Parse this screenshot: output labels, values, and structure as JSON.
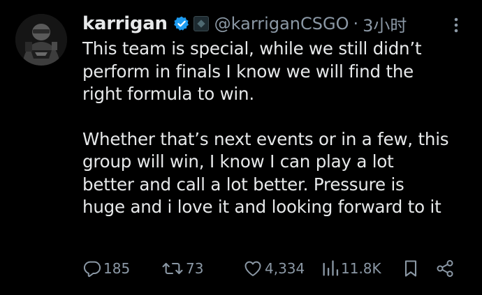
{
  "author": {
    "display_name": "karrigan",
    "handle": "@karriganCSGO",
    "separator": "·",
    "time": "3小时",
    "verified_color": "#1d9bf0",
    "avatar_icon": "avatar-image",
    "more_icon": "more-options-icon"
  },
  "tweet": {
    "paragraphs": [
      [
        "This team is special, while we still didn’t",
        "perform in finals I know we will find the",
        "right formula to win."
      ],
      [
        "Whether that’s next events or in a few, this",
        "group will win, I know I can play a lot",
        "better and call a lot better. Pressure is",
        "huge and i love it and looking forward to it"
      ]
    ]
  },
  "actions": {
    "reply": {
      "icon": "reply-icon",
      "count": "185"
    },
    "retweet": {
      "icon": "retweet-icon",
      "count": "73"
    },
    "like": {
      "icon": "heart-icon",
      "count": "4,334"
    },
    "views": {
      "icon": "views-icon",
      "count": "11.8K"
    },
    "bookmark": {
      "icon": "bookmark-icon"
    },
    "share": {
      "icon": "share-icon"
    }
  },
  "colors": {
    "background": "#000000",
    "text": "#e7e9ea",
    "muted": "#8b98a5",
    "verified": "#1d9bf0"
  }
}
